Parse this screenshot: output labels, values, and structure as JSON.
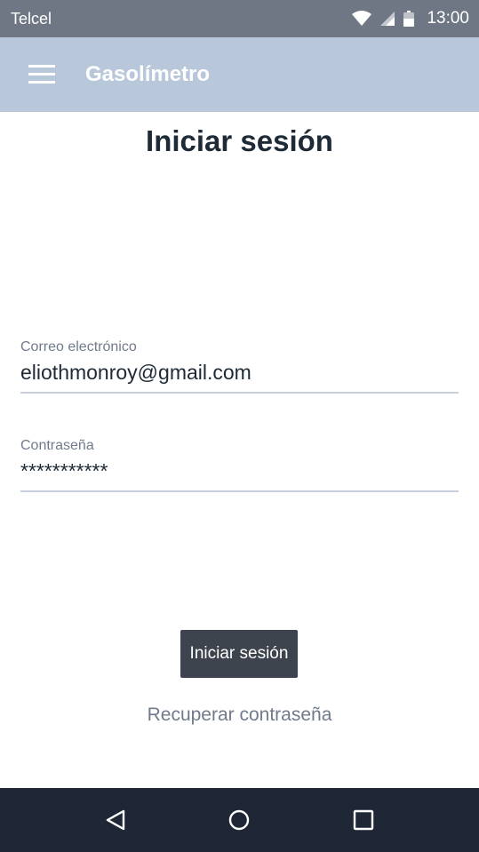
{
  "status_bar": {
    "carrier": "Telcel",
    "time": "13:00",
    "icons": [
      "wifi-icon",
      "signal-icon",
      "battery-icon"
    ]
  },
  "app_bar": {
    "title": "Gasolímetro",
    "menu_icon": "hamburger-menu-icon",
    "background": "#b8c7d9"
  },
  "page": {
    "title": "Iniciar sesión"
  },
  "form": {
    "email": {
      "label": "Correo electrónico",
      "value": "eliothmonroy@gmail.com"
    },
    "password": {
      "label": "Contraseña",
      "value": "***********"
    },
    "submit_label": "Iniciar sesión",
    "recover_label": "Recuperar contraseña"
  },
  "nav_bar": {
    "buttons": [
      "back-icon",
      "home-icon",
      "recents-icon"
    ]
  },
  "colors": {
    "status_bar": "#6f7784",
    "primary_button": "#3e444d",
    "nav_bar": "#1f2736"
  }
}
